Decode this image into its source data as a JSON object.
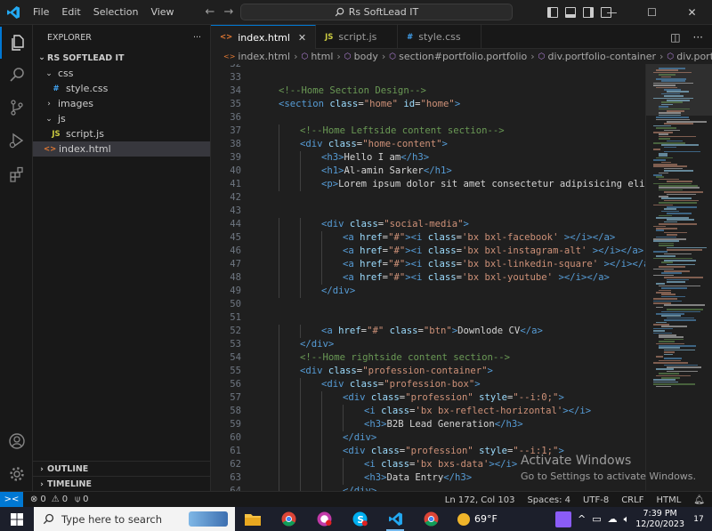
{
  "titlebar": {
    "menu": [
      "File",
      "Edit",
      "Selection",
      "View"
    ],
    "command_center": "Rs SoftLead IT",
    "search_icon": "search-icon"
  },
  "sidebar": {
    "title": "EXPLORER",
    "more": "···",
    "project": "RS SOFTLEAD IT",
    "tree": [
      {
        "label": "css",
        "kind": "folder",
        "depth": 1
      },
      {
        "label": "style.css",
        "kind": "css",
        "depth": 2
      },
      {
        "label": "images",
        "kind": "folder-closed",
        "depth": 1
      },
      {
        "label": "js",
        "kind": "folder",
        "depth": 1
      },
      {
        "label": "script.js",
        "kind": "js",
        "depth": 2
      },
      {
        "label": "index.html",
        "kind": "html",
        "depth": 1,
        "selected": true
      }
    ],
    "outline": "OUTLINE",
    "timeline": "TIMELINE"
  },
  "tabs": [
    {
      "label": "index.html",
      "icon": "<>",
      "active": true,
      "close": "✕"
    },
    {
      "label": "script.js",
      "icon": "JS",
      "active": false
    },
    {
      "label": "style.css",
      "icon": "#",
      "active": false
    }
  ],
  "breadcrumb": [
    "index.html",
    "html",
    "body",
    "section#portfolio.portfolio",
    "div.portfolio-container",
    "div.portfolio-box"
  ],
  "editor": {
    "first_line_partial": "32",
    "lines": [
      {
        "n": "33",
        "indent": 0,
        "tokens": []
      },
      {
        "n": "34",
        "indent": 1,
        "tokens": [
          [
            "com",
            "<!--Home Section Design-->"
          ]
        ]
      },
      {
        "n": "35",
        "indent": 1,
        "tokens": [
          [
            "tag",
            "<section"
          ],
          [
            "txt",
            " "
          ],
          [
            "attr",
            "class"
          ],
          [
            "txt",
            "="
          ],
          [
            "str",
            "\"home\""
          ],
          [
            "txt",
            " "
          ],
          [
            "attr",
            "id"
          ],
          [
            "txt",
            "="
          ],
          [
            "str",
            "\"home\""
          ],
          [
            "tag",
            ">"
          ]
        ]
      },
      {
        "n": "36",
        "indent": 0,
        "tokens": []
      },
      {
        "n": "37",
        "indent": 2,
        "tokens": [
          [
            "com",
            "<!--Home Leftside content section-->"
          ]
        ]
      },
      {
        "n": "38",
        "indent": 2,
        "tokens": [
          [
            "tag",
            "<div"
          ],
          [
            "txt",
            " "
          ],
          [
            "attr",
            "class"
          ],
          [
            "txt",
            "="
          ],
          [
            "str",
            "\"home-content\""
          ],
          [
            "tag",
            ">"
          ]
        ]
      },
      {
        "n": "39",
        "indent": 3,
        "tokens": [
          [
            "tag",
            "<h3>"
          ],
          [
            "txt",
            "Hello I am"
          ],
          [
            "tag",
            "</h3>"
          ]
        ]
      },
      {
        "n": "40",
        "indent": 3,
        "tokens": [
          [
            "tag",
            "<h1>"
          ],
          [
            "txt",
            "Al-amin Sarker"
          ],
          [
            "tag",
            "</h1>"
          ]
        ]
      },
      {
        "n": "41",
        "indent": 3,
        "tokens": [
          [
            "tag",
            "<p>"
          ],
          [
            "txt",
            "Lorem ipsum dolor sit amet consectetur adipisicing elit. S"
          ]
        ]
      },
      {
        "n": "42",
        "indent": 0,
        "tokens": []
      },
      {
        "n": "43",
        "indent": 0,
        "tokens": []
      },
      {
        "n": "44",
        "indent": 3,
        "tokens": [
          [
            "tag",
            "<div"
          ],
          [
            "txt",
            " "
          ],
          [
            "attr",
            "class"
          ],
          [
            "txt",
            "="
          ],
          [
            "str",
            "\"social-media\""
          ],
          [
            "tag",
            ">"
          ]
        ]
      },
      {
        "n": "45",
        "indent": 4,
        "tokens": [
          [
            "tag",
            "<a"
          ],
          [
            "txt",
            " "
          ],
          [
            "attr",
            "href"
          ],
          [
            "txt",
            "="
          ],
          [
            "str",
            "\"#\""
          ],
          [
            "tag",
            "><i"
          ],
          [
            "txt",
            " "
          ],
          [
            "attr",
            "class"
          ],
          [
            "txt",
            "="
          ],
          [
            "str",
            "'bx bxl-facebook'"
          ],
          [
            "txt",
            " "
          ],
          [
            "tag",
            "></i></a>"
          ]
        ]
      },
      {
        "n": "46",
        "indent": 4,
        "tokens": [
          [
            "tag",
            "<a"
          ],
          [
            "txt",
            " "
          ],
          [
            "attr",
            "href"
          ],
          [
            "txt",
            "="
          ],
          [
            "str",
            "\"#\""
          ],
          [
            "tag",
            "><i"
          ],
          [
            "txt",
            " "
          ],
          [
            "attr",
            "class"
          ],
          [
            "txt",
            "="
          ],
          [
            "str",
            "'bx bxl-instagram-alt'"
          ],
          [
            "txt",
            " "
          ],
          [
            "tag",
            "></i></a>"
          ]
        ]
      },
      {
        "n": "47",
        "indent": 4,
        "tokens": [
          [
            "tag",
            "<a"
          ],
          [
            "txt",
            " "
          ],
          [
            "attr",
            "href"
          ],
          [
            "txt",
            "="
          ],
          [
            "str",
            "\"#\""
          ],
          [
            "tag",
            "><i"
          ],
          [
            "txt",
            " "
          ],
          [
            "attr",
            "class"
          ],
          [
            "txt",
            "="
          ],
          [
            "str",
            "'bx bxl-linkedin-square'"
          ],
          [
            "txt",
            " "
          ],
          [
            "tag",
            "></i></a>"
          ]
        ]
      },
      {
        "n": "48",
        "indent": 4,
        "tokens": [
          [
            "tag",
            "<a"
          ],
          [
            "txt",
            " "
          ],
          [
            "attr",
            "href"
          ],
          [
            "txt",
            "="
          ],
          [
            "str",
            "\"#\""
          ],
          [
            "tag",
            "><i"
          ],
          [
            "txt",
            " "
          ],
          [
            "attr",
            "class"
          ],
          [
            "txt",
            "="
          ],
          [
            "str",
            "'bx bxl-youtube'"
          ],
          [
            "txt",
            " "
          ],
          [
            "tag",
            "></i></a>"
          ]
        ]
      },
      {
        "n": "49",
        "indent": 3,
        "tokens": [
          [
            "tag",
            "</div>"
          ]
        ]
      },
      {
        "n": "50",
        "indent": 0,
        "tokens": []
      },
      {
        "n": "51",
        "indent": 0,
        "tokens": []
      },
      {
        "n": "52",
        "indent": 3,
        "tokens": [
          [
            "tag",
            "<a"
          ],
          [
            "txt",
            " "
          ],
          [
            "attr",
            "href"
          ],
          [
            "txt",
            "="
          ],
          [
            "str",
            "\"#\""
          ],
          [
            "txt",
            " "
          ],
          [
            "attr",
            "class"
          ],
          [
            "txt",
            "="
          ],
          [
            "str",
            "\"btn\""
          ],
          [
            "tag",
            ">"
          ],
          [
            "txt",
            "Downlode CV"
          ],
          [
            "tag",
            "</a>"
          ]
        ]
      },
      {
        "n": "53",
        "indent": 2,
        "tokens": [
          [
            "tag",
            "</div>"
          ]
        ]
      },
      {
        "n": "54",
        "indent": 2,
        "tokens": [
          [
            "com",
            "<!--Home rightside content section-->"
          ]
        ]
      },
      {
        "n": "55",
        "indent": 2,
        "tokens": [
          [
            "tag",
            "<div"
          ],
          [
            "txt",
            " "
          ],
          [
            "attr",
            "class"
          ],
          [
            "txt",
            "="
          ],
          [
            "str",
            "\"profession-container\""
          ],
          [
            "tag",
            ">"
          ]
        ]
      },
      {
        "n": "56",
        "indent": 3,
        "tokens": [
          [
            "tag",
            "<div"
          ],
          [
            "txt",
            " "
          ],
          [
            "attr",
            "class"
          ],
          [
            "txt",
            "="
          ],
          [
            "str",
            "\"profession-box\""
          ],
          [
            "tag",
            ">"
          ]
        ]
      },
      {
        "n": "57",
        "indent": 4,
        "tokens": [
          [
            "tag",
            "<div"
          ],
          [
            "txt",
            " "
          ],
          [
            "attr",
            "class"
          ],
          [
            "txt",
            "="
          ],
          [
            "str",
            "\"profession\""
          ],
          [
            "txt",
            " "
          ],
          [
            "attr",
            "style"
          ],
          [
            "txt",
            "="
          ],
          [
            "str",
            "\"--i:0;\""
          ],
          [
            "tag",
            ">"
          ]
        ]
      },
      {
        "n": "58",
        "indent": 5,
        "tokens": [
          [
            "tag",
            "<i"
          ],
          [
            "txt",
            " "
          ],
          [
            "attr",
            "class"
          ],
          [
            "txt",
            "="
          ],
          [
            "str",
            "'bx bx-reflect-horizontal'"
          ],
          [
            "tag",
            "></i>"
          ]
        ]
      },
      {
        "n": "59",
        "indent": 5,
        "tokens": [
          [
            "tag",
            "<h3>"
          ],
          [
            "txt",
            "B2B Lead Generation"
          ],
          [
            "tag",
            "</h3>"
          ]
        ]
      },
      {
        "n": "60",
        "indent": 4,
        "tokens": [
          [
            "tag",
            "</div>"
          ]
        ]
      },
      {
        "n": "61",
        "indent": 4,
        "tokens": [
          [
            "tag",
            "<div"
          ],
          [
            "txt",
            " "
          ],
          [
            "attr",
            "class"
          ],
          [
            "txt",
            "="
          ],
          [
            "str",
            "\"profession\""
          ],
          [
            "txt",
            " "
          ],
          [
            "attr",
            "style"
          ],
          [
            "txt",
            "="
          ],
          [
            "str",
            "\"--i:1;\""
          ],
          [
            "tag",
            ">"
          ]
        ]
      },
      {
        "n": "62",
        "indent": 5,
        "tokens": [
          [
            "tag",
            "<i"
          ],
          [
            "txt",
            " "
          ],
          [
            "attr",
            "class"
          ],
          [
            "txt",
            "="
          ],
          [
            "str",
            "'bx bxs-data'"
          ],
          [
            "tag",
            "></i>"
          ]
        ]
      },
      {
        "n": "63",
        "indent": 5,
        "tokens": [
          [
            "tag",
            "<h3>"
          ],
          [
            "txt",
            "Data Entry"
          ],
          [
            "tag",
            "</h3>"
          ]
        ]
      },
      {
        "n": "64",
        "indent": 4,
        "tokens": [
          [
            "tag",
            "</div>"
          ]
        ]
      }
    ]
  },
  "watermark": {
    "title": "Activate Windows",
    "subtitle": "Go to Settings to activate Windows."
  },
  "statusbar": {
    "remote": "><",
    "errors": "0",
    "warnings": "0",
    "ports": "0",
    "position": "Ln 172, Col 103",
    "spaces": "Spaces: 4",
    "encoding": "UTF-8",
    "eol": "CRLF",
    "language": "HTML"
  },
  "taskbar": {
    "search_placeholder": "Type here to search",
    "weather": "69°F",
    "time": "7:39 PM",
    "date": "12/20/2023",
    "notification_count": "17"
  },
  "colors": {
    "accent": "#0078d4",
    "tag": "#569cd6",
    "attribute": "#9cdcfe",
    "string": "#ce9178",
    "comment": "#6a9955"
  }
}
